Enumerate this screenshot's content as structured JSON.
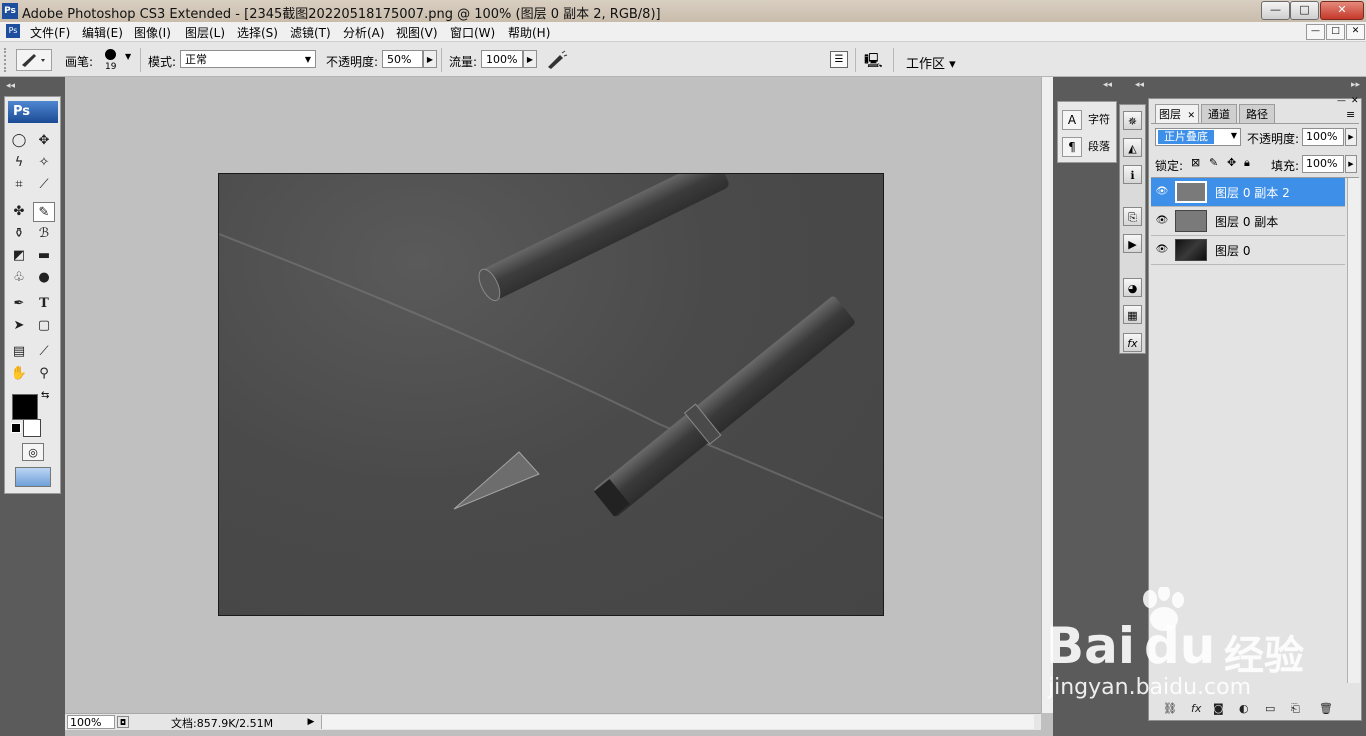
{
  "window": {
    "app_badge": "Ps",
    "title": "Adobe Photoshop CS3 Extended - [2345截图20220518175007.png @ 100% (图层 0 副本 2, RGB/8)]",
    "controls": {
      "minimize": "—",
      "maximize": "□",
      "close": "✕"
    }
  },
  "menu": {
    "items": [
      "文件(F)",
      "编辑(E)",
      "图像(I)",
      "图层(L)",
      "选择(S)",
      "滤镜(T)",
      "分析(A)",
      "视图(V)",
      "窗口(W)",
      "帮助(H)"
    ],
    "doc_controls": [
      "—",
      "□",
      "✕"
    ]
  },
  "options": {
    "brush_label": "画笔:",
    "brush_size": "19",
    "mode_label": "模式:",
    "mode_value": "正常",
    "opacity_label": "不透明度:",
    "opacity_value": "50%",
    "flow_label": "流量:",
    "flow_value": "100%",
    "workspace_label": "工作区 ▾"
  },
  "toolbox": {
    "logo": "Ps"
  },
  "statusbar": {
    "zoom": "100%",
    "doc_info": "文档:857.9K/2.51M"
  },
  "mini_panel": {
    "character_label": "字符",
    "paragraph_label": "段落"
  },
  "layers_panel": {
    "tabs": [
      "图层",
      "通道",
      "路径"
    ],
    "blend_mode": "正片叠底",
    "opacity_label": "不透明度:",
    "opacity_value": "100%",
    "lock_label": "锁定:",
    "fill_label": "填充:",
    "fill_value": "100%",
    "layers": [
      {
        "name": "图层 0 副本 2",
        "selected": true
      },
      {
        "name": "图层 0 副本",
        "selected": false
      },
      {
        "name": "图层 0",
        "selected": false
      }
    ]
  },
  "watermark": {
    "brand": "Bai",
    "brand2": "du",
    "product": "经验",
    "url": "jingyan.baidu.com"
  },
  "colors": {
    "selection": "#3e8fe8",
    "foreground": "#000000",
    "background": "#ffffff"
  }
}
